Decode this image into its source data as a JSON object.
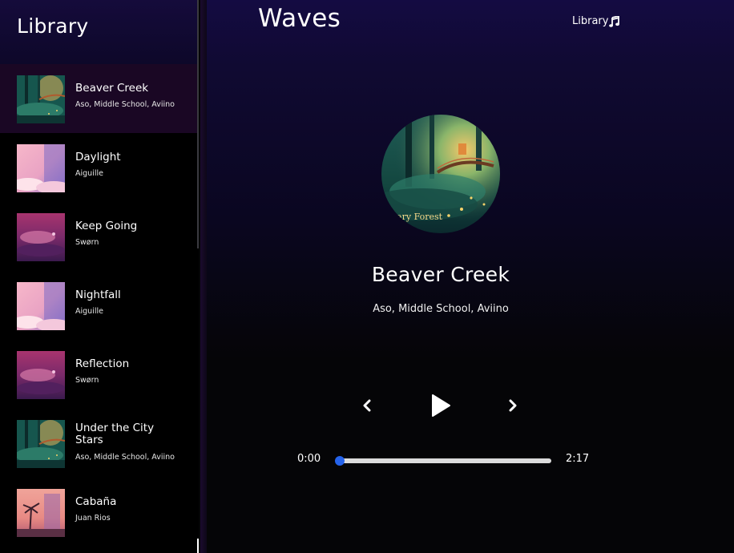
{
  "sidebar": {
    "title": "Library",
    "songs": [
      {
        "name": "Beaver Creek",
        "artist": "Aso, Middle School, Aviino",
        "cover": "forest",
        "active": true
      },
      {
        "name": "Daylight",
        "artist": "Aiguille",
        "cover": "pink-sky",
        "active": false
      },
      {
        "name": "Keep Going",
        "artist": "Swørn",
        "cover": "magenta-island",
        "active": false
      },
      {
        "name": "Nightfall",
        "artist": "Aiguille",
        "cover": "pink-sky",
        "active": false
      },
      {
        "name": "Reflection",
        "artist": "Swørn",
        "cover": "magenta-island",
        "active": false
      },
      {
        "name": "Under the City Stars",
        "artist": "Aso, Middle School, Aviino",
        "cover": "forest",
        "active": false
      },
      {
        "name": "Cabaña",
        "artist": "Juan Rios",
        "cover": "sunset-palm",
        "active": false
      }
    ]
  },
  "nav": {
    "logo": "Waves",
    "library_button": "Library",
    "library_icon": "music-note-icon"
  },
  "player": {
    "cover_text": "nary Forest",
    "title": "Beaver Creek",
    "artist": "Aso, Middle School, Aviino",
    "current_time": "0:00",
    "duration": "2:17",
    "progress": 0.0,
    "prev_icon": "chevron-left-icon",
    "play_icon": "play-icon",
    "next_icon": "chevron-right-icon"
  },
  "colors": {
    "accent": "#2563eb",
    "track": "#dcdcdc",
    "active_row": "#1a0724"
  }
}
